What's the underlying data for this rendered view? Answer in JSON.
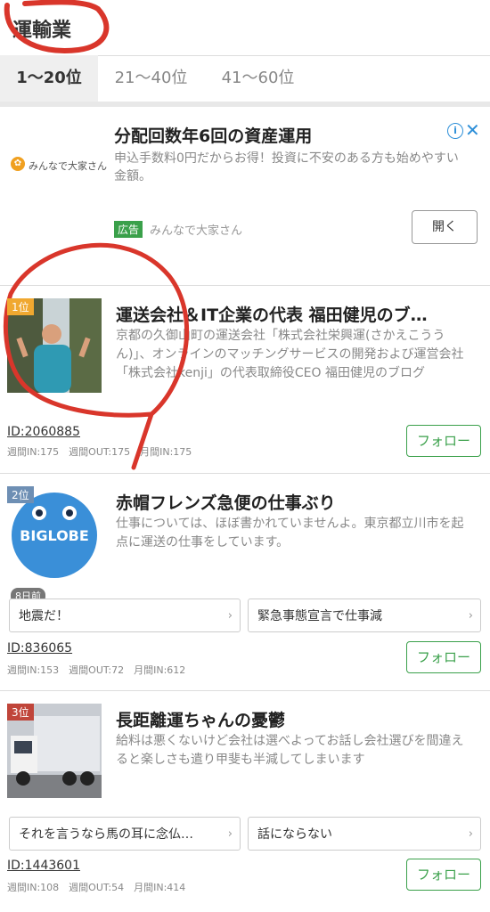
{
  "header": {
    "title": "運輸業"
  },
  "tabs": [
    {
      "label": "1〜20位"
    },
    {
      "label": "21〜40位"
    },
    {
      "label": "41〜60位"
    }
  ],
  "ad": {
    "sponsor_logo_text": "みんなで大家さん",
    "title": "分配回数年6回の資産運用",
    "description": "申込手数料0円だからお得！投資に不安のある方も始めやすい金額。",
    "badge": "広告",
    "sponsor": "みんなで大家さん",
    "open_label": "開く"
  },
  "entries": [
    {
      "rank": "1位",
      "rank_color": "#f0a830",
      "title": "運送会社＆IT企業の代表 福田健児のブ…",
      "description": "京都の久御山町の運送会社「株式会社栄興運(さかえこううん)」、オンラインのマッチングサービスの開発および運営会社「株式会社kenji」の代表取締役CEO 福田健児のブログ",
      "id": "ID:2060885",
      "stats": "週間IN:175　週間OUT:175　月間IN:175",
      "follow_label": "フォロー"
    },
    {
      "rank": "2位",
      "rank_color": "#6e8fb4",
      "title": "赤帽フレンズ急便の仕事ぶり",
      "description": "仕事については、ほぼ書かれていませんよ。東京都立川市を起点に運送の仕事をしています。",
      "thumb_text": "BIGLOBE",
      "days": "8日前",
      "tags": [
        "地震だ！",
        "緊急事態宣言で仕事減"
      ],
      "id": "ID:836065",
      "stats": "週間IN:153　週間OUT:72　月間IN:612",
      "follow_label": "フォロー"
    },
    {
      "rank": "3位",
      "rank_color": "#c0453a",
      "title": "長距離運ちゃんの憂鬱",
      "description": "給料は悪くないけど会社は選べよってお話し会社選びを間違えると楽しさも遣り甲斐も半減してしまいます",
      "tags": [
        "それを言うなら馬の耳に念仏…",
        "話にならない"
      ],
      "id": "ID:1443601",
      "stats": "週間IN:108　週間OUT:54　月間IN:414",
      "follow_label": "フォロー"
    }
  ],
  "colors": {
    "accent_green": "#3aa04a",
    "annotation_red": "#d9362b"
  }
}
